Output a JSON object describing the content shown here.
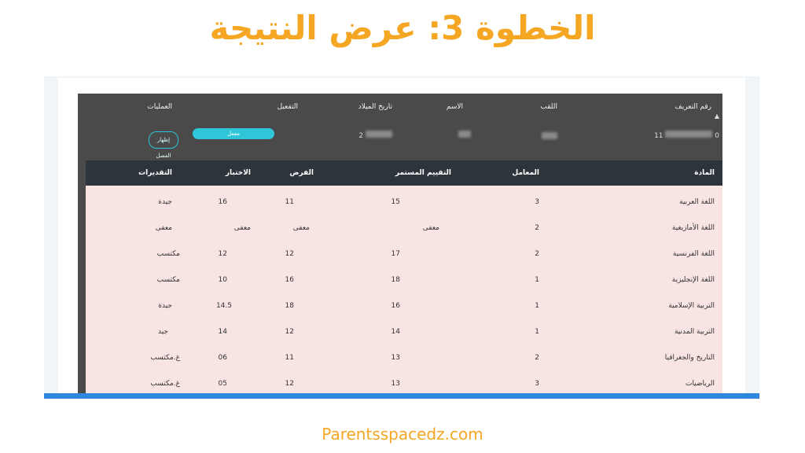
{
  "headline": "الخطوة 3: عرض النتيجة",
  "footer": "Parentsspacedz.com",
  "student": {
    "headers": {
      "id": "رقم التعريف",
      "last_name": "اللقب",
      "first_name": "الاسم",
      "birth_date": "تاريخ الميلاد",
      "activation": "التفعيل",
      "operations": "العمليات"
    },
    "id_prefix": "11",
    "id_suffix": "0",
    "birth_prefix": "2",
    "activation_label": "مفعل",
    "operations_button": "إظهار الفصل"
  },
  "grades": {
    "columns": {
      "subject": "المادة",
      "coefficient": "المعامل",
      "continuous": "التقييم المستمر",
      "exam": "الفرض",
      "test": "الاختبار",
      "appreciation": "التقديرات"
    },
    "rows": [
      {
        "subject": "اللغة العربية",
        "coefficient": "3",
        "continuous": "15",
        "exam": "11",
        "test": "16",
        "appreciation": "جيدة"
      },
      {
        "subject": "اللغة الأمازيغية",
        "coefficient": "2",
        "continuous": "معفى",
        "exam": "معفى",
        "test": "معفى",
        "appreciation": "معفى"
      },
      {
        "subject": "اللغة الفرنسية",
        "coefficient": "2",
        "continuous": "17",
        "exam": "12",
        "test": "12",
        "appreciation": "مكتسب"
      },
      {
        "subject": "اللغة الإنجليزية",
        "coefficient": "1",
        "continuous": "18",
        "exam": "16",
        "test": "10",
        "appreciation": "مكتسب"
      },
      {
        "subject": "التربية الإسلامية",
        "coefficient": "1",
        "continuous": "16",
        "exam": "18",
        "test": "14.5",
        "appreciation": "جيدة"
      },
      {
        "subject": "التربية المدنية",
        "coefficient": "1",
        "continuous": "14",
        "exam": "12",
        "test": "14",
        "appreciation": "جيد"
      },
      {
        "subject": "التاريخ والجغرافيا",
        "coefficient": "2",
        "continuous": "13",
        "exam": "11",
        "test": "06",
        "appreciation": "غ.مكتسب"
      },
      {
        "subject": "الرياضيات",
        "coefficient": "3",
        "continuous": "13",
        "exam": "12",
        "test": "05",
        "appreciation": "غ.مكتسب"
      }
    ]
  },
  "colors": {
    "headline": "#f5a623",
    "accent": "#2ec6d8",
    "table_bg": "#f9e4e4",
    "table_head": "#2e343b",
    "panel": "#4a4a4a",
    "bar": "#2e86de"
  },
  "icons": {
    "caret": "caret-up-icon"
  }
}
